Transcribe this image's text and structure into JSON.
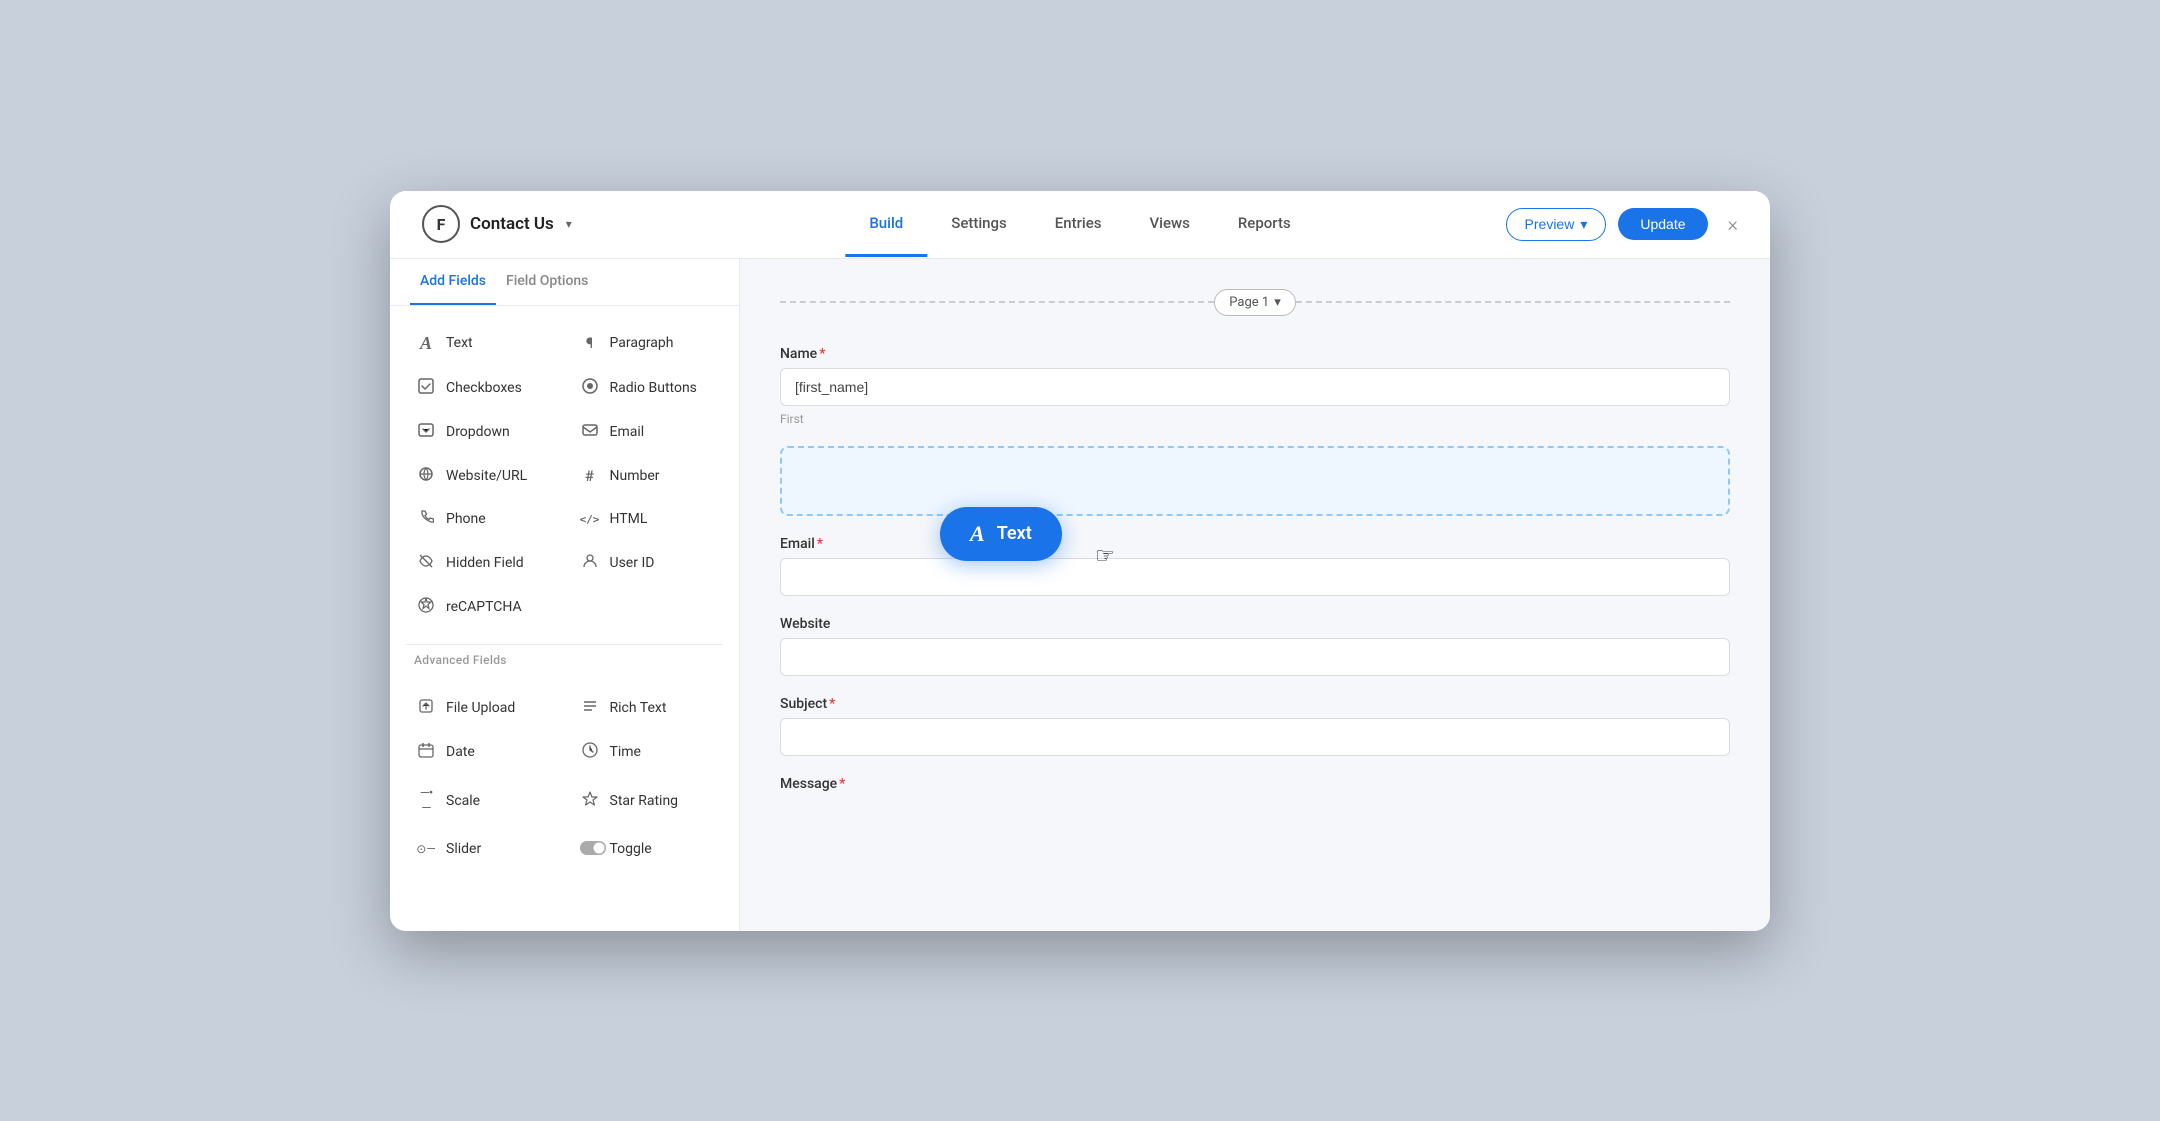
{
  "header": {
    "logo_text": "F",
    "form_title": "Contact Us",
    "nav": [
      {
        "label": "Build",
        "active": true
      },
      {
        "label": "Settings",
        "active": false
      },
      {
        "label": "Entries",
        "active": false
      },
      {
        "label": "Views",
        "active": false
      },
      {
        "label": "Reports",
        "active": false
      }
    ],
    "preview_label": "Preview",
    "update_label": "Update",
    "close_label": "×"
  },
  "sidebar": {
    "tab_add": "Add Fields",
    "tab_options": "Field Options",
    "basic_fields": [
      {
        "icon": "A",
        "label": "Text"
      },
      {
        "icon": "¶",
        "label": "Paragraph"
      },
      {
        "icon": "☑",
        "label": "Checkboxes"
      },
      {
        "icon": "◎",
        "label": "Radio Buttons"
      },
      {
        "icon": "▾",
        "label": "Dropdown"
      },
      {
        "icon": "✉",
        "label": "Email"
      },
      {
        "icon": "🔗",
        "label": "Website/URL"
      },
      {
        "icon": "#",
        "label": "Number"
      },
      {
        "icon": "📞",
        "label": "Phone"
      },
      {
        "icon": "</>",
        "label": "HTML"
      },
      {
        "icon": "👁",
        "label": "Hidden Field"
      },
      {
        "icon": "👤",
        "label": "User ID"
      },
      {
        "icon": "🛡",
        "label": "reCAPTCHA"
      },
      {
        "icon": "",
        "label": ""
      }
    ],
    "advanced_label": "Advanced Fields",
    "advanced_fields": [
      {
        "icon": "↑",
        "label": "File Upload"
      },
      {
        "icon": "≡",
        "label": "Rich Text"
      },
      {
        "icon": "📅",
        "label": "Date"
      },
      {
        "icon": "⏰",
        "label": "Time"
      },
      {
        "icon": "—",
        "label": "Scale"
      },
      {
        "icon": "☆",
        "label": "Star Rating"
      },
      {
        "icon": "⊙",
        "label": "Slider"
      },
      {
        "icon": "⏻",
        "label": "Toggle"
      }
    ]
  },
  "form": {
    "page_label": "Page 1",
    "name_label": "Name",
    "name_placeholder": "[first_name]",
    "name_sublabel": "First",
    "email_label": "Email",
    "website_label": "Website",
    "subject_label": "Subject",
    "message_label": "Message"
  },
  "drag_tooltip": {
    "icon": "A",
    "label": "Text"
  }
}
